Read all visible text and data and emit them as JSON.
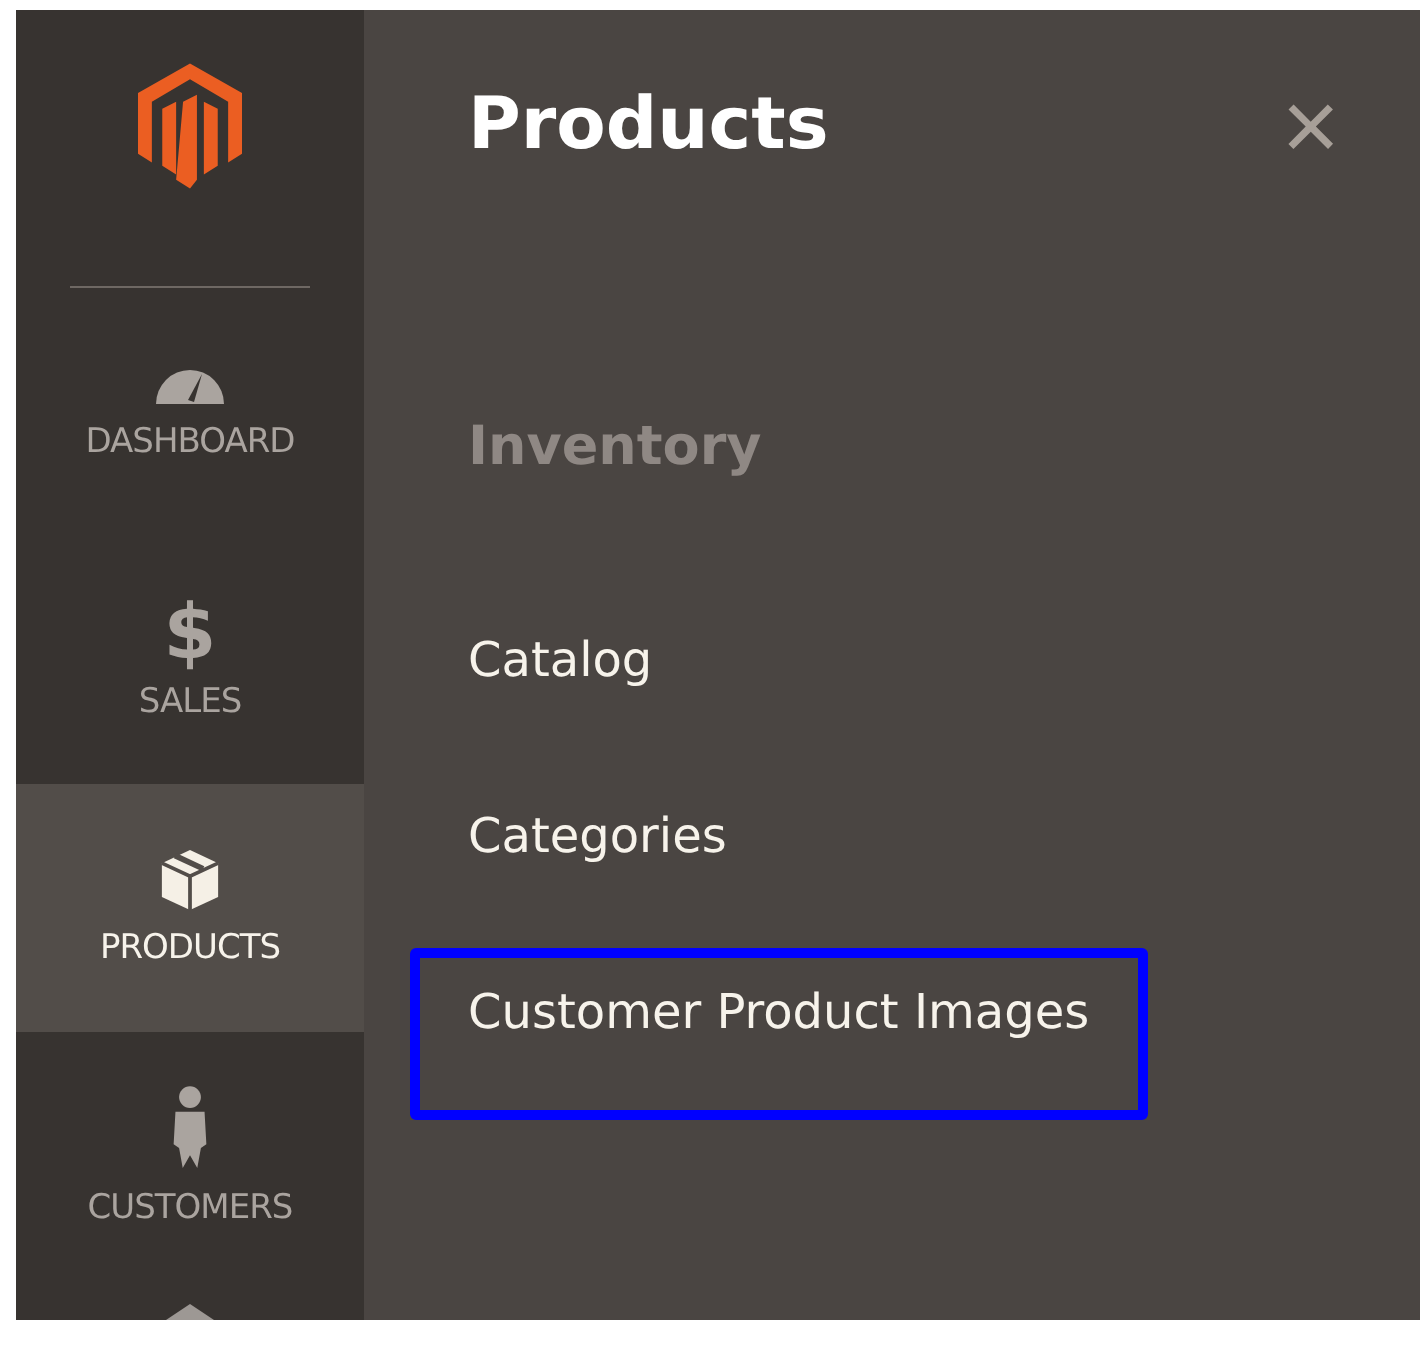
{
  "sidebar": {
    "items": [
      {
        "kind": "dashboard",
        "label": "DASHBOARD",
        "selected": false
      },
      {
        "kind": "sales",
        "icon": "$",
        "label": "SALES",
        "selected": false
      },
      {
        "kind": "products",
        "label": "PRODUCTS",
        "selected": true
      },
      {
        "kind": "customers",
        "label": "CUSTOMERS",
        "selected": false
      }
    ]
  },
  "panel": {
    "title": "Products",
    "close": "×",
    "section": "Inventory",
    "items": [
      {
        "label": "Catalog",
        "highlighted": false
      },
      {
        "label": "Categories",
        "highlighted": false
      },
      {
        "label": "Customer Product Images",
        "highlighted": true
      }
    ]
  }
}
